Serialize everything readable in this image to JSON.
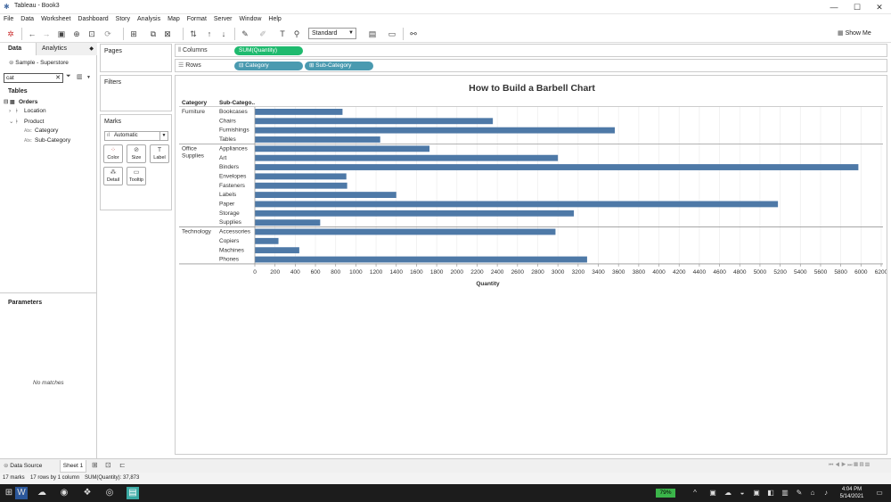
{
  "window": {
    "title": "Tableau - Book3",
    "minimize": "—",
    "maximize": "☐",
    "close": "✕"
  },
  "menu": [
    "File",
    "Data",
    "Worksheet",
    "Dashboard",
    "Story",
    "Analysis",
    "Map",
    "Format",
    "Server",
    "Window",
    "Help"
  ],
  "toolbar": {
    "fit": "Standard",
    "show_me": "Show Me"
  },
  "left": {
    "tab_data": "Data",
    "tab_analytics": "Analytics",
    "datasource": "Sample - Superstore",
    "search_value": "cat",
    "tables_heading": "Tables",
    "tree": {
      "orders": "Orders",
      "location": "Location",
      "product": "Product",
      "category": "Category",
      "subcategory": "Sub-Category"
    },
    "abc": "Abc",
    "parameters_heading": "Parameters",
    "no_matches": "No matches"
  },
  "cards": {
    "pages": "Pages",
    "filters": "Filters",
    "marks": "Marks",
    "marks_type": "Automatic",
    "color": "Color",
    "size": "Size",
    "label": "Label",
    "detail": "Detail",
    "tooltip": "Tooltip"
  },
  "shelves": {
    "columns_label": "Columns",
    "rows_label": "Rows",
    "columns_pill": "SUM(Quantity)",
    "rows_pill_1": "⊟ Category",
    "rows_pill_2": "⊞ Sub-Category"
  },
  "colors": {
    "bar": "#4e79a7",
    "green_pill": "#1fba6e",
    "blue_pill": "#4a9ab0"
  },
  "bottom": {
    "data_source_tab": "Data Source",
    "sheet_tab": "Sheet 1"
  },
  "status": {
    "marks": "17 marks",
    "rows": "17 rows by 1 column",
    "sum": "SUM(Quantity): 37,873"
  },
  "taskbar": {
    "battery": "79%",
    "time": "4:04 PM",
    "date": "5/14/2021"
  },
  "chart_data": {
    "type": "bar",
    "title": "How to Build a Barbell Chart",
    "row_headers": [
      "Category",
      "Sub-Catego.."
    ],
    "xlabel": "Quantity",
    "xlim": [
      0,
      6200
    ],
    "xticks": [
      0,
      200,
      400,
      600,
      800,
      1000,
      1200,
      1400,
      1600,
      1800,
      2000,
      2200,
      2400,
      2600,
      2800,
      3000,
      3200,
      3400,
      3600,
      3800,
      4000,
      4200,
      4400,
      4600,
      4800,
      5000,
      5200,
      5400,
      5600,
      5800,
      6000,
      6200
    ],
    "groups": [
      {
        "category": "Furniture",
        "items": [
          {
            "name": "Bookcases",
            "value": 868
          },
          {
            "name": "Chairs",
            "value": 2356
          },
          {
            "name": "Furnishings",
            "value": 3563
          },
          {
            "name": "Tables",
            "value": 1241
          }
        ]
      },
      {
        "category": "Office\nSupplies",
        "items": [
          {
            "name": "Appliances",
            "value": 1729
          },
          {
            "name": "Art",
            "value": 3000
          },
          {
            "name": "Binders",
            "value": 5974
          },
          {
            "name": "Envelopes",
            "value": 906
          },
          {
            "name": "Fasteners",
            "value": 914
          },
          {
            "name": "Labels",
            "value": 1400
          },
          {
            "name": "Paper",
            "value": 5178
          },
          {
            "name": "Storage",
            "value": 3158
          },
          {
            "name": "Supplies",
            "value": 647
          }
        ]
      },
      {
        "category": "Technology",
        "items": [
          {
            "name": "Accessories",
            "value": 2976
          },
          {
            "name": "Copiers",
            "value": 234
          },
          {
            "name": "Machines",
            "value": 440
          },
          {
            "name": "Phones",
            "value": 3289
          }
        ]
      }
    ]
  }
}
